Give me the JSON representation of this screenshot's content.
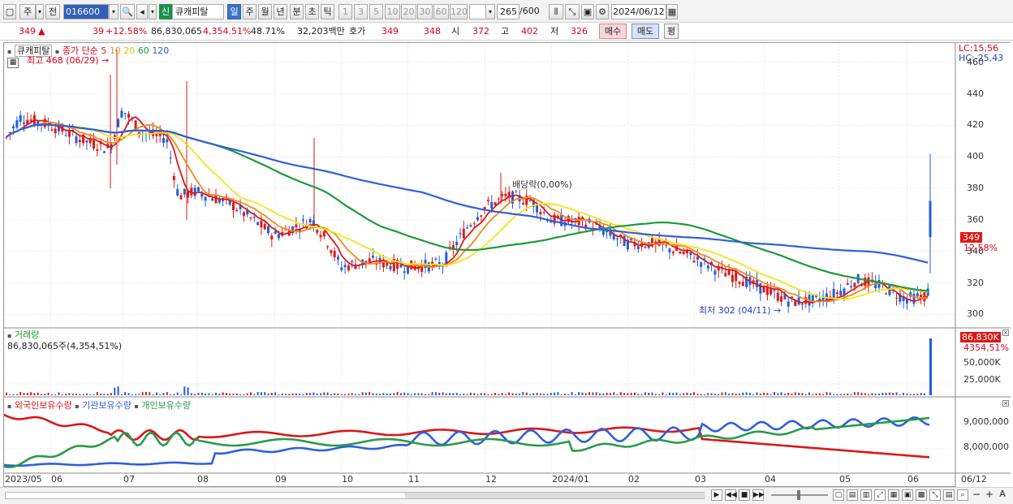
{
  "toolbar": {
    "market": "주",
    "prev_label": "전",
    "stock_code": "016600",
    "badge": "신",
    "stock_name": "큐캐피탈",
    "periods": [
      "일",
      "주",
      "월",
      "년",
      "분",
      "초",
      "틱"
    ],
    "active_period": "일",
    "intervals": [
      "1",
      "3",
      "5",
      "10",
      "20",
      "30",
      "60",
      "120"
    ],
    "count": "265",
    "count_total": "/600",
    "date": "2024/06/12"
  },
  "quote": {
    "price": "349",
    "change": "39",
    "change_pct": "+12.58%",
    "volume": "86,830,065",
    "volume_pct": "4,354.51%",
    "turnover": "48.71%",
    "amount": "32,203백만",
    "hoga_label": "호가",
    "ask": "349",
    "bid": "348",
    "open_label": "시",
    "open": "372",
    "high_label": "고",
    "high": "402",
    "low_label": "저",
    "low": "326",
    "buy_btn": "매수",
    "sell_btn": "매도",
    "eval_btn": "평"
  },
  "price_pane": {
    "name": "큐캐피탈",
    "ma_label": "종가 단순",
    "ma_periods": [
      "5",
      "10",
      "20",
      "60",
      "120"
    ],
    "ma_colors": [
      "#e01818",
      "#f08a1c",
      "#f2e41a",
      "#1f9a3a",
      "#2f5fdc"
    ],
    "high_note": "최고 468 (06/29)",
    "low_note": "최저 302 (04/11)",
    "div_note": "배당락(0,00%)",
    "lc": "LC:15,56",
    "hc": "HC:-25,43",
    "price_tag": "349",
    "pct_tag": "12,58%"
  },
  "volume_pane": {
    "title": "거래량",
    "value": "86,830,065주(4,354,51%)",
    "tag": "86,830K",
    "tag_pct": "4354,51%"
  },
  "holding_pane": {
    "labels": [
      "외국인보유수량",
      "기관보유수량",
      "개인보유수량"
    ],
    "colors": [
      "#d81818",
      "#2f5fdc",
      "#2a9a4a"
    ]
  },
  "chart_data": {
    "type": "candlestick",
    "price_ticks": [
      "460",
      "440",
      "420",
      "400",
      "380",
      "360",
      "340",
      "320",
      "300"
    ],
    "price_values": [
      460,
      440,
      420,
      400,
      380,
      360,
      340,
      320,
      300
    ],
    "ylim": [
      292,
      466
    ],
    "volume_ticks": [
      "50,000K",
      "25,000K"
    ],
    "holding_ticks": [
      "9,000,000",
      "8,000,000"
    ],
    "x_labels": [
      "2023/05",
      "06",
      "07",
      "08",
      "09",
      "10",
      "11",
      "12",
      "2024/01",
      "02",
      "03",
      "04",
      "05",
      "06",
      "06/12"
    ],
    "last_close": 349,
    "period_high": 468,
    "period_low": 302
  },
  "bottom": {
    "icons": [
      "play-icon",
      "rewind-icon",
      "stop-icon",
      "forward-icon"
    ]
  }
}
